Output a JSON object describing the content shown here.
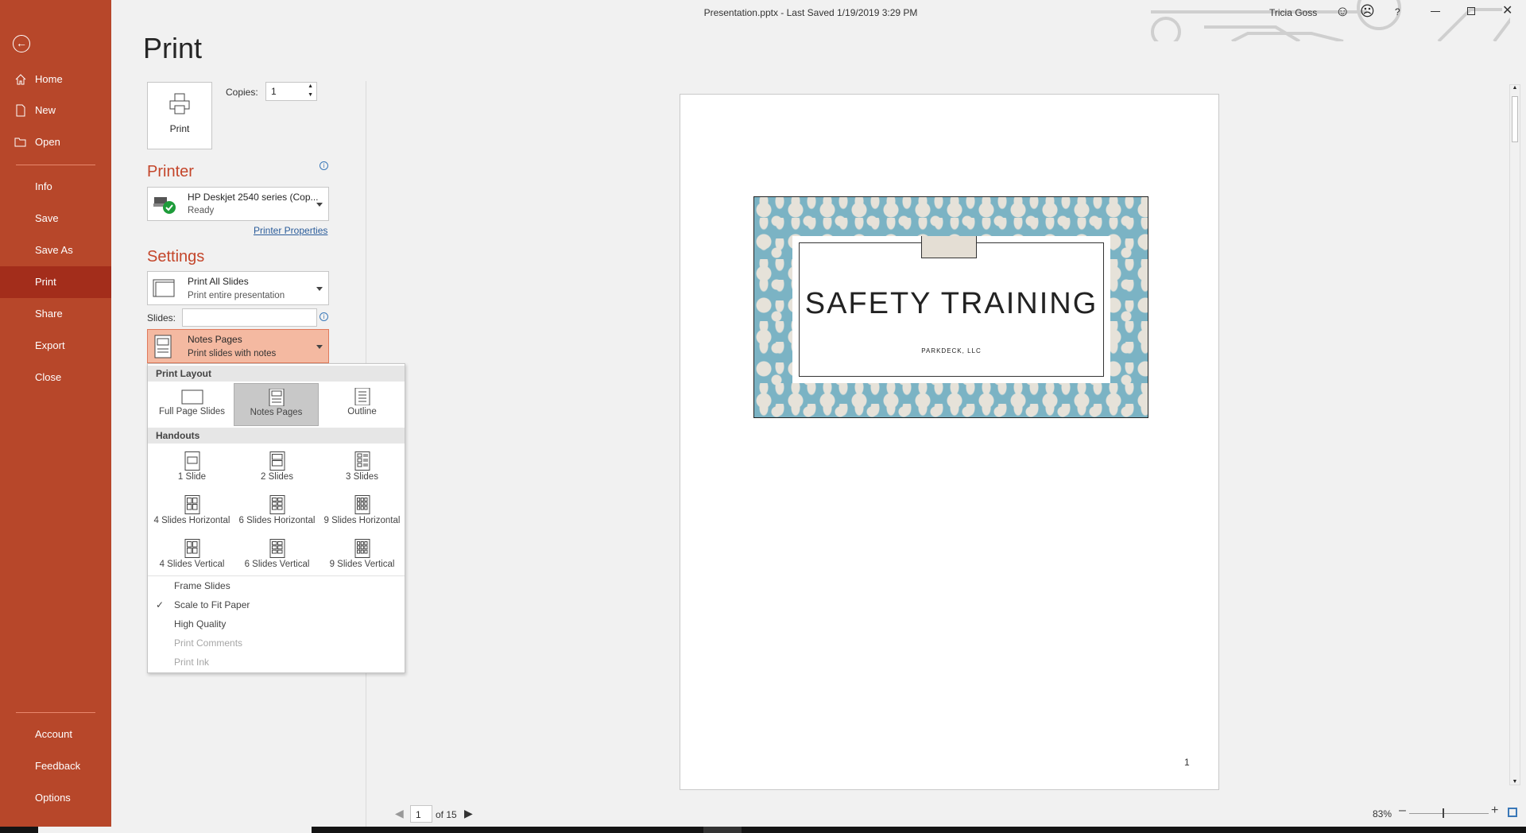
{
  "window": {
    "title": "Presentation.pptx  -  Last Saved 1/19/2019 3:29 PM",
    "user": "Tricia Goss",
    "help": "?"
  },
  "sidebar": {
    "items": [
      {
        "label": "Home"
      },
      {
        "label": "New"
      },
      {
        "label": "Open"
      },
      {
        "label": "Info"
      },
      {
        "label": "Save"
      },
      {
        "label": "Save As"
      },
      {
        "label": "Print"
      },
      {
        "label": "Share"
      },
      {
        "label": "Export"
      },
      {
        "label": "Close"
      }
    ],
    "bottom": [
      {
        "label": "Account"
      },
      {
        "label": "Feedback"
      },
      {
        "label": "Options"
      }
    ],
    "active": "Print",
    "color": "#b7472a"
  },
  "print": {
    "page_title": "Print",
    "button_label": "Print",
    "copies_label": "Copies:",
    "copies_value": "1"
  },
  "printer": {
    "heading": "Printer",
    "name": "HP Deskjet 2540 series (Cop...",
    "status": "Ready",
    "properties_link": "Printer Properties"
  },
  "settings": {
    "heading": "Settings",
    "range_title": "Print All Slides",
    "range_sub": "Print entire presentation",
    "slides_label": "Slides:",
    "slides_value": "",
    "layout_title": "Notes Pages",
    "layout_sub": "Print slides with notes"
  },
  "menu": {
    "print_layout_header": "Print Layout",
    "layouts": [
      {
        "label": "Full Page Slides"
      },
      {
        "label": "Notes Pages",
        "selected": true
      },
      {
        "label": "Outline"
      }
    ],
    "handouts_header": "Handouts",
    "handouts": [
      {
        "label": "1 Slide"
      },
      {
        "label": "2 Slides"
      },
      {
        "label": "3 Slides"
      },
      {
        "label": "4 Slides Horizontal"
      },
      {
        "label": "6 Slides Horizontal"
      },
      {
        "label": "9 Slides Horizontal"
      },
      {
        "label": "4 Slides Vertical"
      },
      {
        "label": "6 Slides Vertical"
      },
      {
        "label": "9 Slides Vertical"
      }
    ],
    "options": [
      {
        "label": "Frame Slides",
        "checked": false,
        "disabled": false
      },
      {
        "label": "Scale to Fit Paper",
        "checked": true,
        "disabled": false
      },
      {
        "label": "High Quality",
        "checked": false,
        "disabled": false
      },
      {
        "label": "Print Comments",
        "checked": false,
        "disabled": true
      },
      {
        "label": "Print Ink",
        "checked": false,
        "disabled": true
      }
    ]
  },
  "preview": {
    "slide_title": "SAFETY TRAINING",
    "slide_subtitle": "PARKDECK,  LLC",
    "page_number": "1",
    "current_page": "1",
    "page_total": "of 15",
    "zoom": "83%"
  }
}
